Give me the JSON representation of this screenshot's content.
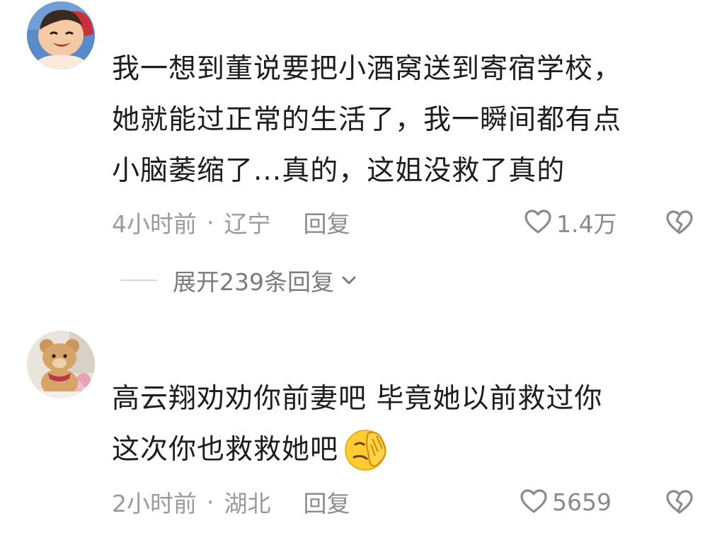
{
  "comments": [
    {
      "lines": [
        "我一想到董说要把小酒窝送到寄宿学校，",
        "她就能过正常的生活了，我一瞬间都有点",
        "小脑萎缩了...真的，这姐没救了真的"
      ],
      "time": "4小时前",
      "dot": "·",
      "location": "辽宁",
      "reply_label": "回复",
      "likes": "1.4万",
      "expand_label": "展开239条回复",
      "avatar_icon": "child-portrait-avatar",
      "like_icon": "heart-outline-icon",
      "dislike_icon": "broken-heart-icon"
    },
    {
      "lines": [
        "高云翔劝劝你前妻吧 毕竟她以前救过你",
        "这次你也救救她吧"
      ],
      "emoji_icon": "face-palm-emoji",
      "time": "2小时前",
      "dot": "·",
      "location": "湖北",
      "reply_label": "回复",
      "likes": "5659",
      "avatar_icon": "teddy-bear-avatar",
      "like_icon": "heart-outline-icon",
      "dislike_icon": "broken-heart-icon"
    }
  ],
  "colors": {
    "body_text": "#1d1d1d",
    "meta_text": "#9a9a9a",
    "icon_gray": "#8a8a8a",
    "divider": "#d8d8d8",
    "background": "#ffffff"
  }
}
